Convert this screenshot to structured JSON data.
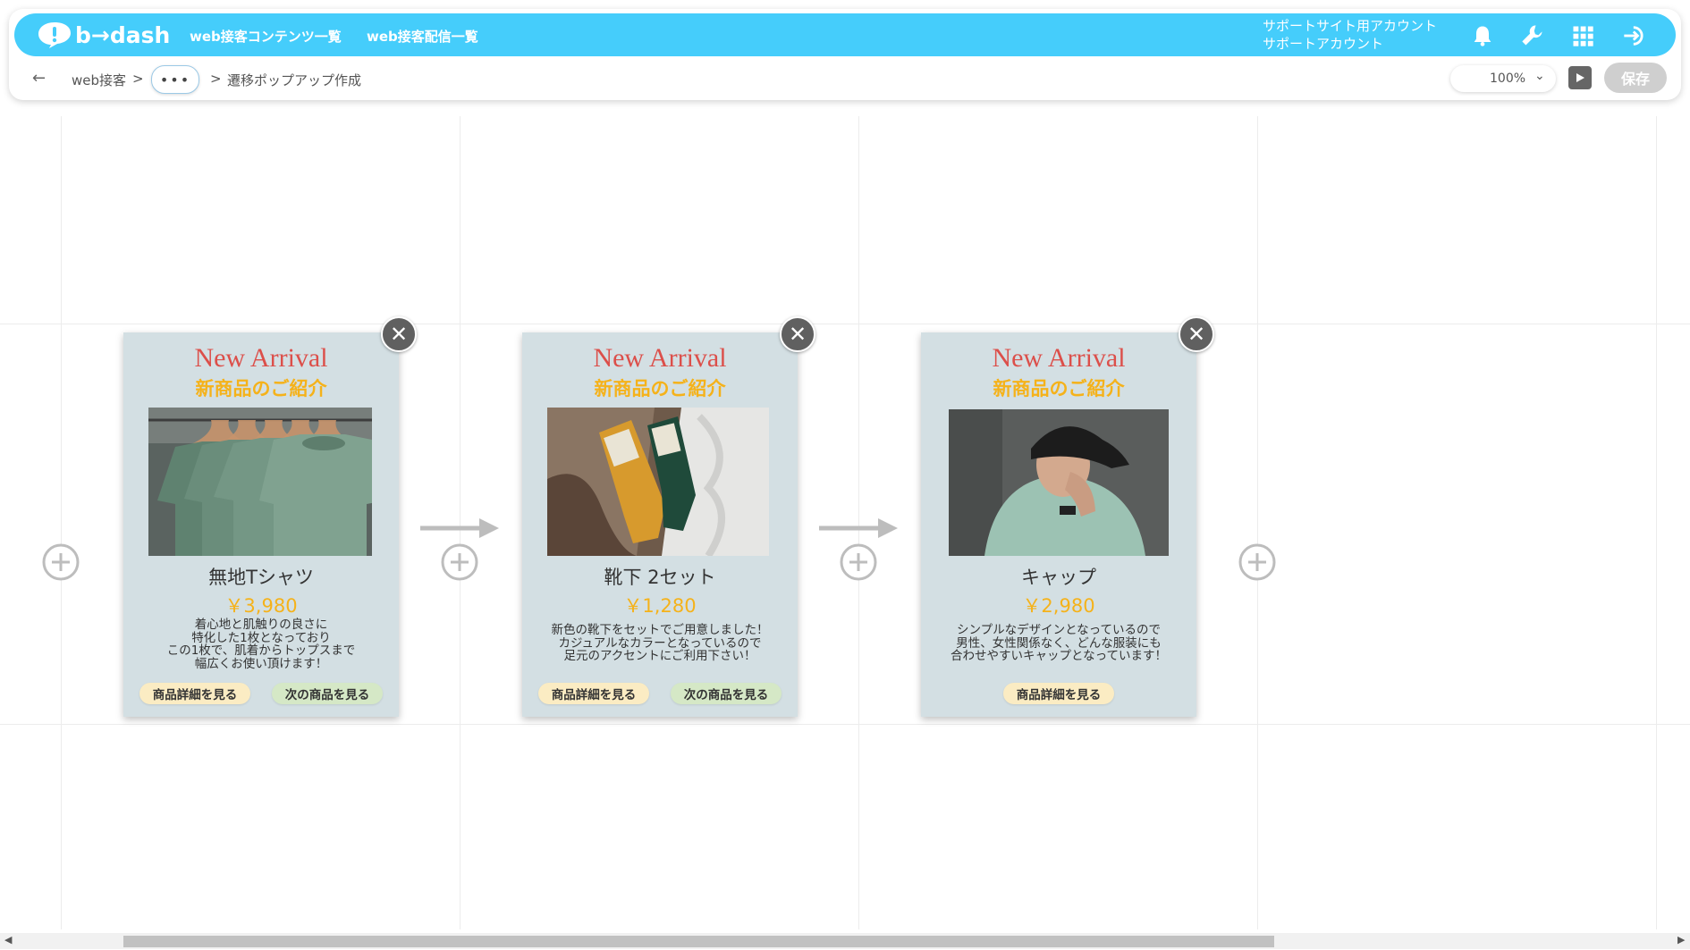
{
  "app": {
    "logo_text": "b→dash",
    "nav": [
      "web接客コンテンツ一覧",
      "web接客配信一覧"
    ],
    "account": {
      "line1": "サポートサイト用アカウント",
      "line2": "サポートアカウント"
    },
    "icons": [
      "bell-icon",
      "wrench-icon",
      "grid-apps-icon",
      "logout-icon"
    ]
  },
  "breadcrumb": {
    "back": "←",
    "root": "web接客",
    "sep": ">",
    "more": "•••",
    "current": "遷移ポップアップ作成"
  },
  "toolbar": {
    "zoom": "100%",
    "save_label": "保存"
  },
  "popups": [
    {
      "title": "New Arrival",
      "subtitle": "新商品のご紹介",
      "image": "green-tshirts-on-hangers",
      "name": "無地Tシャツ",
      "price": "￥3,980",
      "description": "着心地と肌触りの良さに\n特化した1枚となっており\nこの1枚で、肌着からトップスまで\n幅広くお使い頂けます！",
      "buttons": [
        "商品詳細を見る",
        "次の商品を見る"
      ]
    },
    {
      "title": "New Arrival",
      "subtitle": "新商品のご紹介",
      "image": "socks-set",
      "name": "靴下 2セット",
      "price": "￥1,280",
      "description": "新色の靴下をセットでご用意しました！\nカジュアルなカラーとなっているので\n足元のアクセントにご利用下さい！",
      "buttons": [
        "商品詳細を見る",
        "次の商品を見る"
      ]
    },
    {
      "title": "New Arrival",
      "subtitle": "新商品のご紹介",
      "image": "man-in-black-cap",
      "name": "キャップ",
      "price": "￥2,980",
      "description": "シンプルなデザインとなっているので\n男性、女性関係なく、どんな服装にも\n合わせやすいキャップとなっています！",
      "buttons": [
        "商品詳細を見る"
      ]
    }
  ],
  "colors": {
    "brand": "#45cdfb",
    "popup_bg": "#d3dfe3",
    "title_red": "#dc4f4a",
    "accent_yellow": "#f5b21a",
    "detail_btn": "#fbecc3",
    "next_btn": "#d5e8c6"
  }
}
